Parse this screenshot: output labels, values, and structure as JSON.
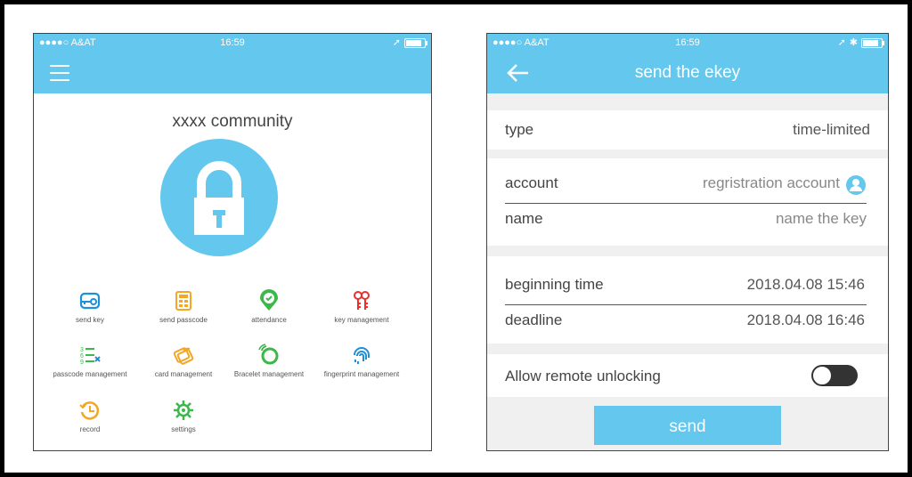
{
  "status_left": {
    "carrier": "●●●●○  A&AT",
    "time": "16:59"
  },
  "status_right": {
    "carrier": "●●●●○  A&AT",
    "time": "16:59"
  },
  "home": {
    "title": "xxxx community",
    "menu": [
      {
        "label": "send key",
        "icon": "key-card-icon"
      },
      {
        "label": "send passcode",
        "icon": "keypad-icon"
      },
      {
        "label": "attendance",
        "icon": "location-check-icon"
      },
      {
        "label": "key management",
        "icon": "keys-icon"
      },
      {
        "label": "passcode management",
        "icon": "number-list-icon"
      },
      {
        "label": "card management",
        "icon": "cards-icon"
      },
      {
        "label": "Bracelet management",
        "icon": "bracelet-icon"
      },
      {
        "label": "fingerprint management",
        "icon": "fingerprint-icon"
      },
      {
        "label": "record",
        "icon": "history-icon"
      },
      {
        "label": "settings",
        "icon": "gear-icon"
      }
    ]
  },
  "ekey": {
    "title": "send the ekey",
    "type_label": "type",
    "type_value": "time-limited",
    "account_label": "account",
    "account_placeholder": "regristration account",
    "name_label": "name",
    "name_placeholder": "name the key",
    "begin_label": "beginning time",
    "begin_value": "2018.04.08 15:46",
    "deadline_label": "deadline",
    "deadline_value": "2018.04.08 16:46",
    "remote_label": "Allow remote unlocking",
    "remote_enabled": false,
    "send_label": "send"
  },
  "colors": {
    "accent": "#64c7ee",
    "orange": "#f5a623",
    "green": "#3bb84a",
    "red": "#e8312f",
    "blue": "#1e90d6"
  }
}
